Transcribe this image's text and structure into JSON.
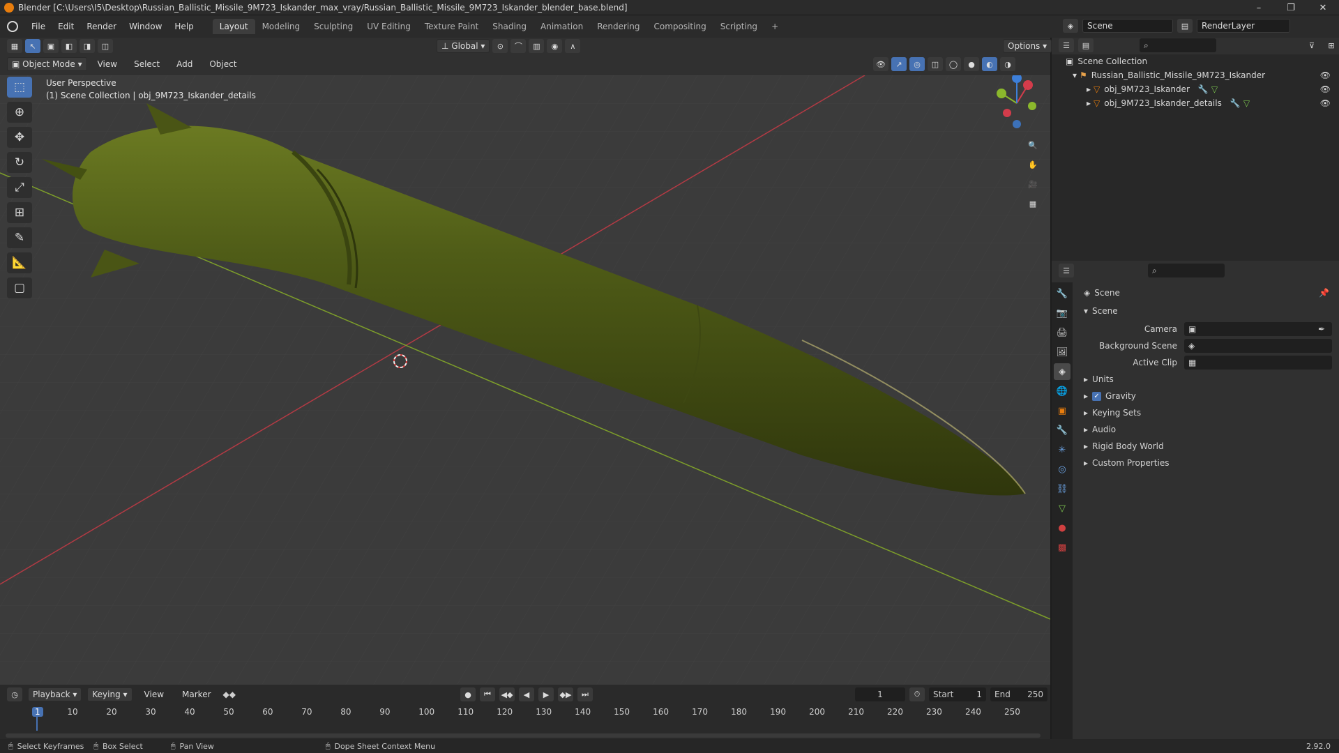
{
  "window": {
    "title": "Blender [C:\\Users\\I5\\Desktop\\Russian_Ballistic_Missile_9M723_Iskander_max_vray/Russian_Ballistic_Missile_9M723_Iskander_blender_base.blend]",
    "minimize_glyph": "–",
    "maximize_glyph": "❐",
    "close_glyph": "✕"
  },
  "menu": [
    "File",
    "Edit",
    "Render",
    "Window",
    "Help"
  ],
  "workspaces": [
    "Layout",
    "Modeling",
    "Sculpting",
    "UV Editing",
    "Texture Paint",
    "Shading",
    "Animation",
    "Rendering",
    "Compositing",
    "Scripting"
  ],
  "workspace_add": "+",
  "scene_name": "Scene",
  "render_layer": "RenderLayer",
  "header": {
    "transform_orientation": "Global",
    "options_label": "Options",
    "mode": "Object Mode",
    "view_menu": [
      "View",
      "Select",
      "Add",
      "Object"
    ]
  },
  "viewport": {
    "perspective_label": "User Perspective",
    "context_label": "(1) Scene Collection | obj_9M723_Iskander_details",
    "gizmo": {
      "x": "X",
      "y": "Y",
      "z": "Z"
    }
  },
  "outliner": {
    "root": "Scene Collection",
    "collection": "Russian_Ballistic_Missile_9M723_Iskander",
    "objects": [
      "obj_9M723_Iskander",
      "obj_9M723_Iskander_details"
    ]
  },
  "properties": {
    "context_name": "Scene",
    "panel_title": "Scene",
    "fields": [
      {
        "label": "Camera"
      },
      {
        "label": "Background Scene"
      },
      {
        "label": "Active Clip"
      }
    ],
    "sections": [
      "Units",
      "Gravity",
      "Keying Sets",
      "Audio",
      "Rigid Body World",
      "Custom Properties"
    ],
    "gravity_checked": true
  },
  "timeline": {
    "menus": [
      "Playback",
      "Keying",
      "View",
      "Marker"
    ],
    "current_frame": "1",
    "start_label": "Start",
    "start": "1",
    "end_label": "End",
    "end": "250",
    "ticks": [
      "1",
      "10",
      "20",
      "30",
      "40",
      "50",
      "60",
      "70",
      "80",
      "90",
      "100",
      "110",
      "120",
      "130",
      "140",
      "150",
      "160",
      "170",
      "180",
      "190",
      "200",
      "210",
      "220",
      "230",
      "240",
      "250"
    ]
  },
  "status": {
    "items": [
      "Select Keyframes",
      "Box Select",
      "Pan View",
      "Dope Sheet Context Menu"
    ],
    "version": "2.92.0"
  },
  "colors": {
    "accent": "#4772b3",
    "x_axis": "#d33c4b",
    "y_axis": "#8bb82c",
    "z_axis": "#3d7fd9",
    "missile": "#4e5a16",
    "blender_orange": "#e87d0d"
  }
}
